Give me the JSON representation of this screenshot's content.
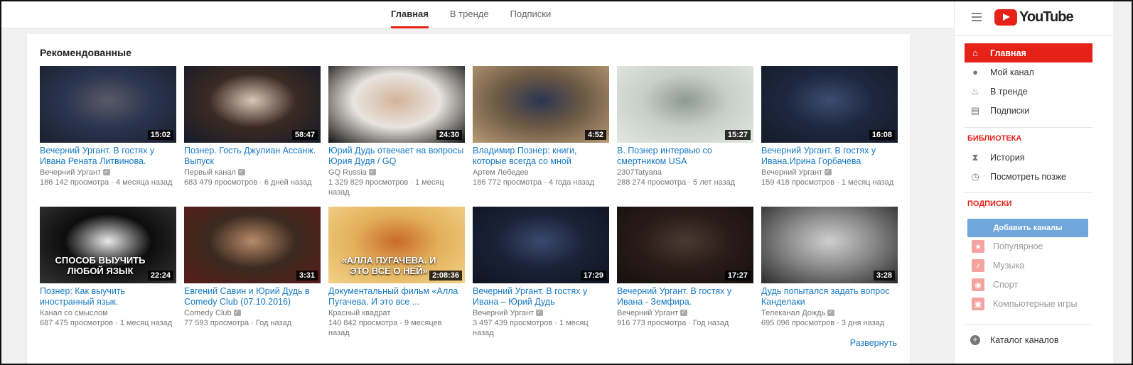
{
  "tabs": [
    "Главная",
    "В тренде",
    "Подписки"
  ],
  "shelf": {
    "title": "Рекомендованные",
    "more_label": "Развернуть"
  },
  "videos": [
    {
      "title": "Вечерний Ургант. В гостях у Ивана Рената Литвинова.",
      "channel": "Вечерний Ургант",
      "verified": true,
      "views": "186 142 просмотра",
      "age": "4 месяца назад",
      "duration": "15:02",
      "thumb_colors": [
        "#2a3550",
        "#5b5a66",
        "#1a1f2e"
      ]
    },
    {
      "title": "Познер. Гость Джулиан Ассанж. Выпуск",
      "channel": "Первый канал",
      "verified": true,
      "views": "683 479 просмотров",
      "age": "6 дней назад",
      "duration": "58:47",
      "thumb_colors": [
        "#3a2a22",
        "#d9c7b8",
        "#151a2a"
      ]
    },
    {
      "title": "Юрий Дудь отвечает на вопросы Юрия Дудя / GQ",
      "channel": "GQ Russia",
      "verified": true,
      "views": "1 329 829 просмотров",
      "age": "1 месяц назад",
      "duration": "24:30",
      "thumb_colors": [
        "#e8e4df",
        "#d4b39a",
        "#111111"
      ]
    },
    {
      "title": "Владимир Познер: книги, которые всегда со мной",
      "channel": "Артем Лебедев",
      "verified": false,
      "views": "186 772 просмотра",
      "age": "4 года назад",
      "duration": "4:52",
      "thumb_colors": [
        "#6d5a45",
        "#2c3550",
        "#b89a74"
      ]
    },
    {
      "title": "В. Познер интервью со смертником USA",
      "channel": "2307Tatyana",
      "verified": false,
      "views": "288 274 просмотра",
      "age": "5 лет назад",
      "duration": "15:27",
      "thumb_colors": [
        "#c7cfc8",
        "#8f9a92",
        "#e3e7e1"
      ]
    },
    {
      "title": "Вечерний Ургант. В гостях у Ивана.Ирина Горбачева",
      "channel": "Вечерний Ургант",
      "verified": true,
      "views": "159 418 просмотров",
      "age": "1 месяц назад",
      "duration": "16:08",
      "thumb_colors": [
        "#1d2840",
        "#3d4c70",
        "#141a28"
      ]
    },
    {
      "title": "Познер: Как выучить иностранный язык.",
      "channel": "Канал со смыслом",
      "verified": false,
      "views": "687 475 просмотров",
      "age": "1 месяц назад",
      "duration": "22:24",
      "thumb_colors": [
        "#0d0d0d",
        "#e9e9e9",
        "#333333"
      ],
      "overlay": "СПОСОБ ВЫУЧИТЬ ЛЮБОЙ ЯЗЫК"
    },
    {
      "title": "Евгений Савин и Юрий Дудь в Comedy Club (07.10.2016)",
      "channel": "Comedy Club",
      "verified": true,
      "views": "77 593 просмотра",
      "age": "Год назад",
      "duration": "3:31",
      "thumb_colors": [
        "#3a2a1f",
        "#b88a6a",
        "#5a1c1c"
      ]
    },
    {
      "title": "Документальный фильм «Алла Пугачева. И это все ...",
      "channel": "Красный квадрат",
      "verified": false,
      "views": "140 842 просмотра",
      "age": "9 месяцев назад",
      "duration": "2:08:36",
      "thumb_colors": [
        "#e3b05a",
        "#c96a2a",
        "#f2d28a"
      ],
      "overlay": "«АЛЛА ПУГАЧЕВА. И ЭТО ВСЁ О НЕЙ»"
    },
    {
      "title": "Вечерний Ургант. В гостях у Ивана – Юрий Дудь",
      "channel": "Вечерний Ургант",
      "verified": true,
      "views": "3 497 439 просмотров",
      "age": "1 месяц назад",
      "duration": "17:29",
      "thumb_colors": [
        "#1a2238",
        "#3a4a6e",
        "#0f1420"
      ]
    },
    {
      "title": "Вечерний Ургант. В гостях у Ивана - Земфира.",
      "channel": "Вечерний Ургант",
      "verified": true,
      "views": "916 773 просмотра",
      "age": "Год назад",
      "duration": "17:27",
      "thumb_colors": [
        "#2a1c18",
        "#4a3a32",
        "#16100e"
      ]
    },
    {
      "title": "Дудь попытался задать вопрос Канделаки",
      "channel": "Телеканал Дождь",
      "verified": true,
      "views": "695 096 просмотров",
      "age": "3 дня назад",
      "duration": "3:28",
      "thumb_colors": [
        "#8a8a8a",
        "#cfcfcf",
        "#2a2a2a"
      ]
    }
  ],
  "sidebar": {
    "logo_text": "YouTube",
    "main_items": [
      {
        "label": "Главная",
        "icon": "home-icon",
        "glyph": "⌂"
      },
      {
        "label": "Мой канал",
        "icon": "user-icon",
        "glyph": "●"
      },
      {
        "label": "В тренде",
        "icon": "flame-icon",
        "glyph": "♨"
      },
      {
        "label": "Подписки",
        "icon": "subscriptions-icon",
        "glyph": "▤"
      }
    ],
    "library_title": "БИБЛИОТЕКА",
    "library_items": [
      {
        "label": "История",
        "icon": "hourglass-icon",
        "glyph": "⧗"
      },
      {
        "label": "Посмотреть позже",
        "icon": "clock-icon",
        "glyph": "◷"
      }
    ],
    "subs_title": "ПОДПИСКИ",
    "add_channels": "Добавить каналы",
    "sub_items": [
      {
        "label": "Популярное",
        "icon": "star-icon",
        "glyph": "★"
      },
      {
        "label": "Музыка",
        "icon": "music-icon",
        "glyph": "♪"
      },
      {
        "label": "Спорт",
        "icon": "ball-icon",
        "glyph": "◉"
      },
      {
        "label": "Компьютерные игры",
        "icon": "gamepad-icon",
        "glyph": "▣"
      }
    ],
    "catalog": "Каталог каналов"
  }
}
